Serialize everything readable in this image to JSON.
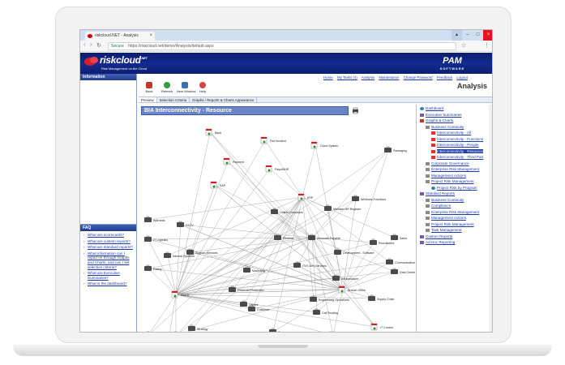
{
  "browser": {
    "tab_title": "riskcloud.NET - Analysis",
    "tab_close": "×",
    "secure_label": "Secure",
    "url": "https://riskcloud.net/demo/Analysis/default.aspx",
    "back_glyph": "‹",
    "forward_glyph": "›",
    "reload_glyph": "↻",
    "home_glyph": "⌂",
    "star_glyph": "☆",
    "menu_glyph": "⋮"
  },
  "window_controls": {
    "user": "▴",
    "minimize": "–",
    "maximize": "□",
    "close": "×"
  },
  "header": {
    "brand": "riskcloud",
    "brand_suffix": ".NET",
    "tagline": "Risk Management on the Cloud",
    "vendor": "PAM",
    "vendor_sub": "SOFTWARE"
  },
  "top_links": [
    "Home",
    "My Tasks (4)",
    "Analysis",
    "Maintenance",
    "Change Password",
    "Feedback",
    "Logout"
  ],
  "page_title": "Analysis",
  "left": {
    "info_heading": "Information",
    "faq_heading": "FAQ",
    "faq_items": [
      "What are scorecards?",
      "What are custom reports?",
      "What are standard reports?",
      "What information can I report on through Graphs and Charts, and can I set selection criteria?",
      "What are Executive Summaries?",
      "What is the dashboard?"
    ]
  },
  "toolbar": {
    "buttons": [
      {
        "label": "Back",
        "color": "#c0392b"
      },
      {
        "label": "Refresh",
        "color": "#2e9e3f"
      },
      {
        "label": "New Window",
        "color": "#3a6fb0"
      },
      {
        "label": "Help",
        "color": "#d64545"
      }
    ]
  },
  "subtabs": [
    "Preview",
    "Selection Criteria",
    "Graphs / Reports & Charts Appearance"
  ],
  "graph": {
    "title": "BIA Interconnectivity - Resource",
    "nodes": [
      {
        "label": "Bank",
        "kind": "doc"
      },
      {
        "label": "Fire Incident",
        "kind": "doc"
      },
      {
        "label": "Payment",
        "kind": "doc"
      },
      {
        "label": "Cloud System",
        "kind": "doc"
      },
      {
        "label": "Packaging",
        "kind": "case"
      },
      {
        "label": "Payroll/HR",
        "kind": "doc"
      },
      {
        "label": "SAP",
        "kind": "doc"
      },
      {
        "label": "ERP",
        "kind": "doc"
      },
      {
        "label": "Online Customers",
        "kind": "case"
      },
      {
        "label": "Maintain HR Register",
        "kind": "case"
      },
      {
        "label": "Windows Functions",
        "kind": "case"
      },
      {
        "label": "Warrants",
        "kind": "case"
      },
      {
        "label": "CCTV",
        "kind": "case"
      },
      {
        "label": "General",
        "kind": "case"
      },
      {
        "label": "Accounts Payable",
        "kind": "case"
      },
      {
        "label": "Sales",
        "kind": "case"
      },
      {
        "label": "IT Logistics",
        "kind": "case"
      },
      {
        "label": "Internal Systems",
        "kind": "case"
      },
      {
        "label": "Support Services",
        "kind": "case"
      },
      {
        "label": "Development - Software",
        "kind": "case"
      },
      {
        "label": "Recruitment",
        "kind": "case"
      },
      {
        "label": "Communications Infrastructure",
        "kind": "case"
      },
      {
        "label": "Rating",
        "kind": "case"
      },
      {
        "label": "Marketing",
        "kind": "case"
      },
      {
        "label": "IT/IS Dev Services",
        "kind": "case"
      },
      {
        "label": "Infrastructure",
        "kind": "case"
      },
      {
        "label": "Data Centre",
        "kind": "case"
      },
      {
        "label": "Financial Production",
        "kind": "case"
      },
      {
        "label": "Branch Office",
        "kind": "doc"
      },
      {
        "label": "Utilities",
        "kind": "case"
      },
      {
        "label": "Oracle",
        "kind": "doc"
      },
      {
        "label": "Engineering Operations",
        "kind": "case"
      },
      {
        "label": "Supply Chain",
        "kind": "case"
      },
      {
        "label": "Customer",
        "kind": "case"
      },
      {
        "label": "Call Routing",
        "kind": "case"
      },
      {
        "label": "Strategy",
        "kind": "case"
      },
      {
        "label": "IT Control",
        "kind": "doc"
      },
      {
        "label": "Management",
        "kind": "case"
      },
      {
        "label": "Research",
        "kind": "case"
      },
      {
        "label": "Treasury",
        "kind": "case"
      },
      {
        "label": "CRM",
        "kind": "doc"
      },
      {
        "label": "Engineering and Technical Services",
        "kind": "case"
      }
    ]
  },
  "tree": {
    "items": [
      {
        "label": "Dashboard",
        "level": 0,
        "icon": "globe-icon"
      },
      {
        "label": "Executive Summaries",
        "level": 0,
        "icon": "book-icon"
      },
      {
        "label": "Graphs & Charts",
        "level": 0,
        "icon": "chart-icon"
      },
      {
        "label": "Business Continuity",
        "level": 1,
        "icon": "folder-icon"
      },
      {
        "label": "Interconnectivity - All",
        "level": 2,
        "icon": "star-icon"
      },
      {
        "label": "Interconnectivity - Functions",
        "level": 2,
        "icon": "star-icon"
      },
      {
        "label": "Interconnectivity - People",
        "level": 2,
        "icon": "star-icon"
      },
      {
        "label": "Interconnectivity - Resource",
        "level": 2,
        "icon": "star-icon",
        "selected": true
      },
      {
        "label": "Interconnectivity - Third Part",
        "level": 2,
        "icon": "star-icon"
      },
      {
        "label": "Corporate Governance",
        "level": 1,
        "icon": "folder-icon"
      },
      {
        "label": "Enterprise Risk Management",
        "level": 1,
        "icon": "folder-icon"
      },
      {
        "label": "Management Actions",
        "level": 1,
        "icon": "folder-icon"
      },
      {
        "label": "Project Risk Management",
        "level": 1,
        "icon": "folder-icon"
      },
      {
        "label": "Project Risk by Program",
        "level": 2,
        "icon": "globe-icon"
      },
      {
        "label": "Standard Reports",
        "level": 0,
        "icon": "book-icon"
      },
      {
        "label": "Business Continuity",
        "level": 1,
        "icon": "folder-icon"
      },
      {
        "label": "Compliance",
        "level": 1,
        "icon": "folder-icon"
      },
      {
        "label": "Enterprise Risk Management",
        "level": 1,
        "icon": "folder-icon"
      },
      {
        "label": "Management Actions",
        "level": 1,
        "icon": "folder-icon"
      },
      {
        "label": "Project Risk Management",
        "level": 1,
        "icon": "folder-icon"
      },
      {
        "label": "Task Management",
        "level": 1,
        "icon": "folder-icon"
      },
      {
        "label": "Custom Reports",
        "level": 0,
        "icon": "book-icon"
      },
      {
        "label": "Ad Hoc Reporting",
        "level": 0,
        "icon": "book-icon"
      }
    ]
  },
  "colors": {
    "header_navy": "#0d1f72",
    "link_blue": "#1a3aa8",
    "graph_title_bg": "#6a86c7",
    "close_red": "#e81123"
  }
}
